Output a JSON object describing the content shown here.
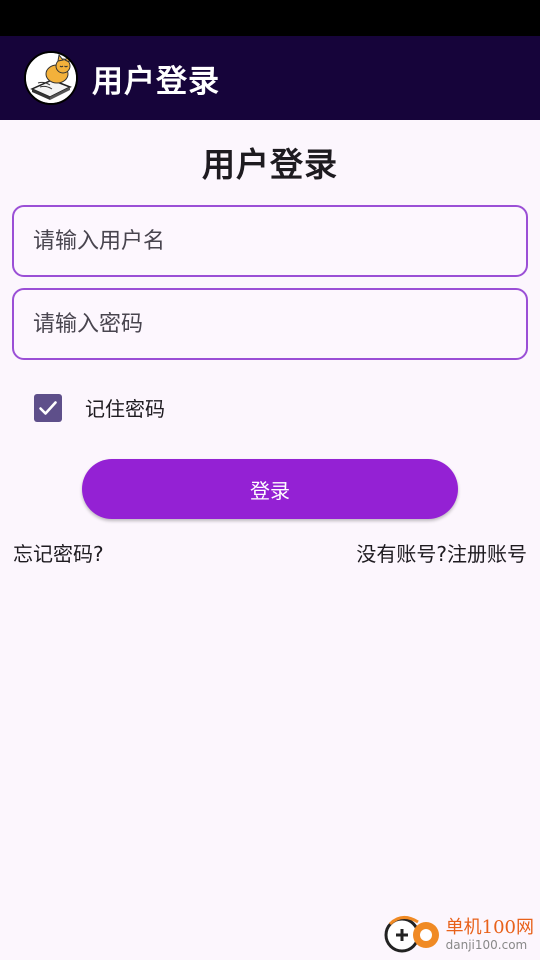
{
  "app_bar": {
    "title": "用户登录",
    "avatar_icon": "cat-reading-book-icon"
  },
  "page": {
    "title": "用户登录"
  },
  "form": {
    "username_placeholder": "请输入用户名",
    "username_value": "",
    "password_placeholder": "请输入密码",
    "password_value": "",
    "remember_label": "记住密码",
    "remember_checked": true,
    "login_label": "登录"
  },
  "links": {
    "forgot": "忘记密码?",
    "register": "没有账号?注册账号"
  },
  "watermark": {
    "name": "单机100网",
    "url": "danji100.com"
  },
  "colors": {
    "app_bar_bg": "#16043a",
    "primary": "#9421d4",
    "field_border": "#9b4fd6",
    "checkbox": "#5e4f8a",
    "background": "#fcf6fd"
  }
}
